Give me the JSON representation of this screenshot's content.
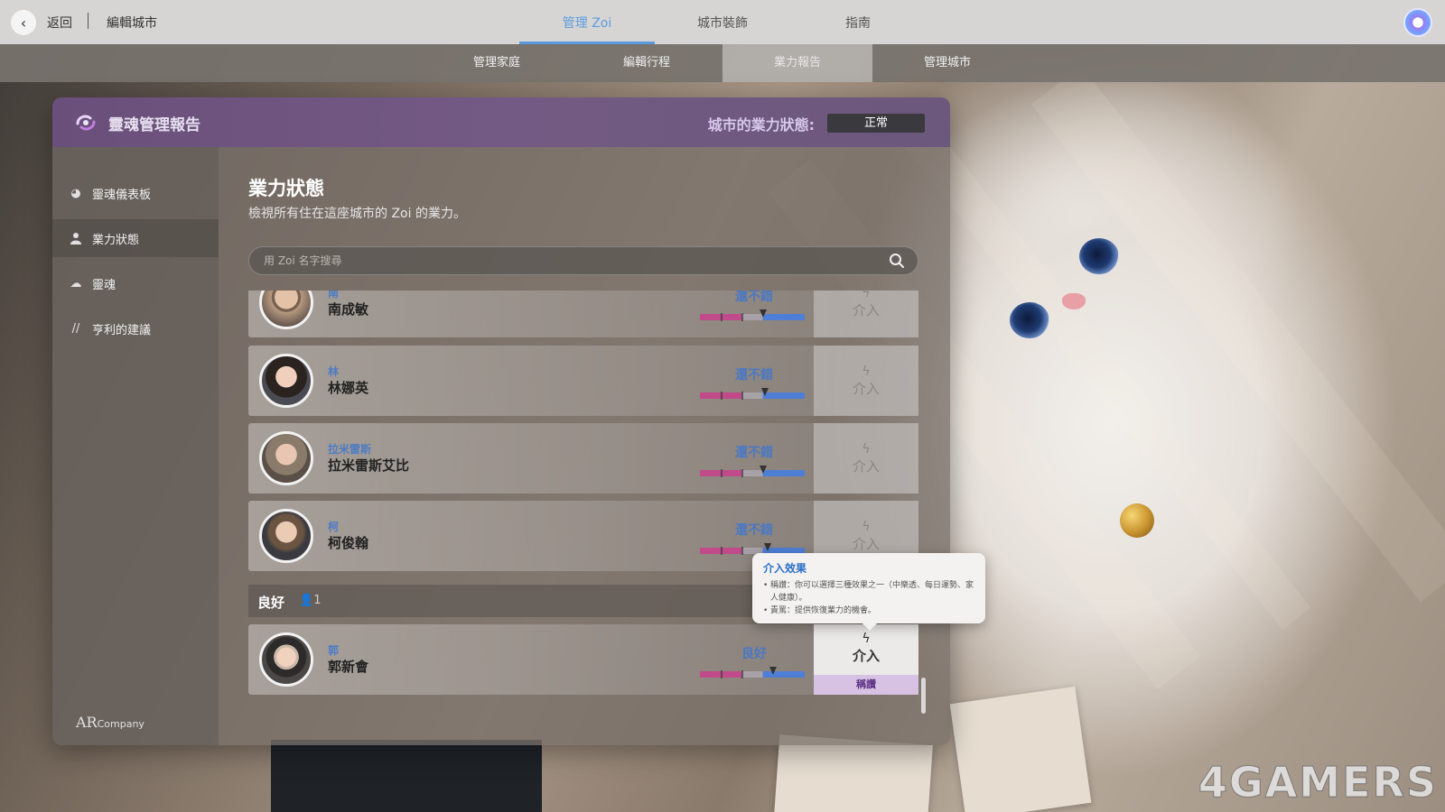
{
  "topbar": {
    "back_label": "返回",
    "edit_city_label": "編輯城市",
    "tabs": [
      {
        "label": "管理 Zoi",
        "active": true
      },
      {
        "label": "城市裝飾",
        "active": false
      },
      {
        "label": "指南",
        "active": false
      }
    ]
  },
  "subbar": {
    "tabs": [
      {
        "label": "管理家庭",
        "active": false
      },
      {
        "label": "編輯行程",
        "active": false
      },
      {
        "label": "業力報告",
        "active": true
      },
      {
        "label": "管理城市",
        "active": false
      }
    ]
  },
  "panel": {
    "title": "靈魂管理報告",
    "karma_state_label": "城市的業力狀態:",
    "karma_state_value": "正常",
    "accent_color": "#6a4f7a"
  },
  "sidebar": {
    "items": [
      {
        "label": "靈魂儀表板",
        "icon": "dashboard-icon",
        "active": false
      },
      {
        "label": "業力狀態",
        "icon": "person-icon",
        "active": true
      },
      {
        "label": "靈魂",
        "icon": "soul-icon",
        "active": false
      },
      {
        "label": "亨利的建議",
        "icon": "quote-icon",
        "active": false
      }
    ],
    "brand_main": "AR",
    "brand_small": "Company"
  },
  "content": {
    "title": "業力狀態",
    "subtitle": "檢視所有住在這座城市的 Zoi 的業力。",
    "search_placeholder": "用 Zoi 名字搜尋"
  },
  "rows": [
    {
      "surname": "南",
      "fullname": "南成敏",
      "status": "還不錯",
      "karma_level": 0.6,
      "intervene_label": "介入",
      "enabled": false
    },
    {
      "surname": "林",
      "fullname": "林娜英",
      "status": "還不錯",
      "karma_level": 0.62,
      "intervene_label": "介入",
      "enabled": false
    },
    {
      "surname": "拉米雷斯",
      "fullname": "拉米雷斯艾比",
      "status": "還不錯",
      "karma_level": 0.6,
      "intervene_label": "介入",
      "enabled": false
    },
    {
      "surname": "柯",
      "fullname": "柯俊翰",
      "status": "還不錯",
      "karma_level": 0.65,
      "intervene_label": "介入",
      "enabled": false
    }
  ],
  "group": {
    "title": "良好",
    "count": "1",
    "rows": [
      {
        "surname": "郭",
        "fullname": "郭新會",
        "status": "良好",
        "karma_level": 0.7,
        "intervene_label": "介入",
        "praise_label": "稱讚",
        "enabled": true
      }
    ]
  },
  "tooltip": {
    "title": "介入效果",
    "lines": [
      "稱讚：你可以選擇三種效果之一（中樂透、每日運勢、家人健康）。",
      "責罵：提供恢復業力的機會。"
    ]
  },
  "watermark": "4GAMERS"
}
